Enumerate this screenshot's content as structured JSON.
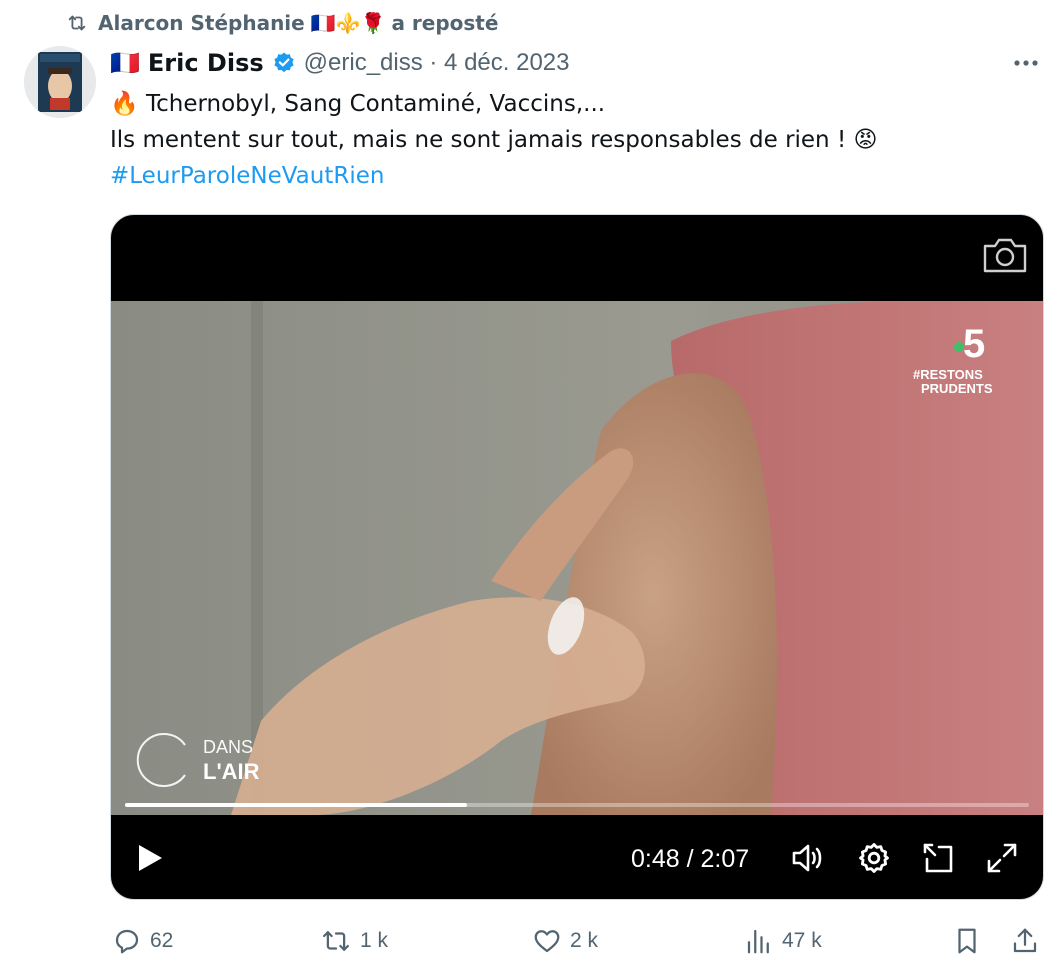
{
  "repost": {
    "icon": "repost-icon",
    "user": "Alarcon Stéphanie",
    "emojis": "🇫🇷⚜️🌹",
    "suffix": "a reposté"
  },
  "tweet": {
    "flag": "🇫🇷",
    "author_name": "Eric Diss",
    "verified_icon": "verified-badge-icon",
    "handle_and_date": "@eric_diss · 4 déc. 2023",
    "more_icon": "more-options-icon",
    "line1": "🔥 Tchernobyl, Sang Contaminé, Vaccins,...",
    "line2": "Ils mentent sur tout, mais ne sont jamais responsables de rien ! 😡",
    "hashtag": "#LeurParoleNeVautRien"
  },
  "media": {
    "channel_number": "5",
    "channel_tag1": "#RESTONS",
    "channel_tag2": "PRUDENTS",
    "show_line1": "DANS",
    "show_line2": "L'AIR",
    "progress_fraction": 0.378,
    "time_display": "0:48 / 2:07",
    "icons": [
      "camera-icon",
      "play-icon",
      "volume-icon",
      "settings-icon",
      "pip-icon",
      "fullscreen-icon"
    ]
  },
  "actions": {
    "replies": "62",
    "reposts": "1 k",
    "likes": "2 k",
    "views": "47 k"
  },
  "colors": {
    "accent": "#1d9bf0",
    "secondary_text": "#536471",
    "primary_text": "#0f1419"
  }
}
